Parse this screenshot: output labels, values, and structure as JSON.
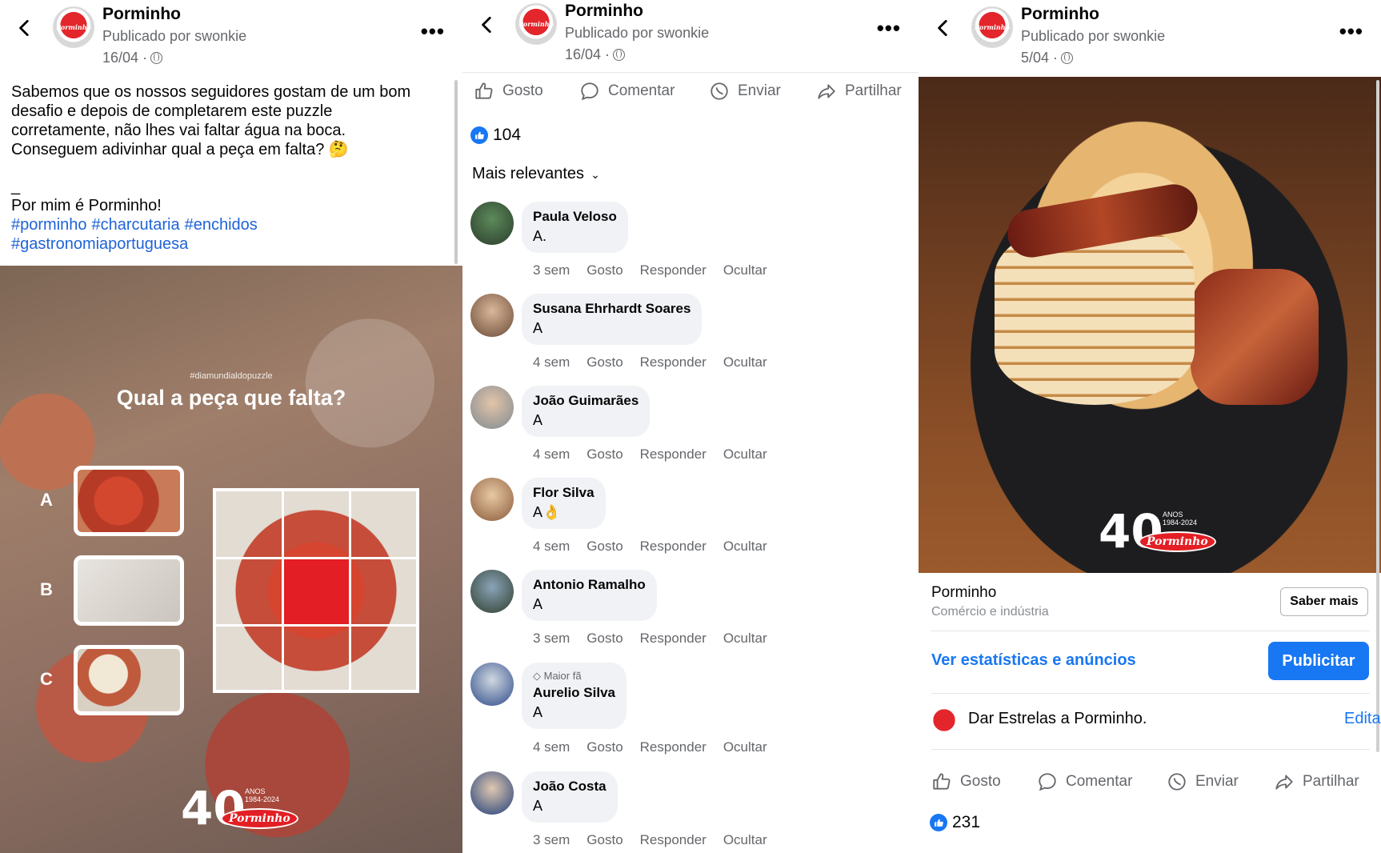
{
  "post1": {
    "page_name": "Porminho",
    "published_by": "Publicado por swonkie",
    "date": "16/04 ·",
    "caption_lines": [
      "Sabemos que os nossos seguidores gostam de um bom",
      "desafio e depois de completarem este puzzle",
      "corretamente, não lhes vai faltar água na boca.",
      "Conseguem adivinhar qual a peça em falta? 🤔",
      "",
      "_",
      "Por mim é Porminho!"
    ],
    "hashtags": [
      "#porminho",
      "#charcutaria",
      "#enchidos",
      "#gastronomiaportuguesa"
    ],
    "image": {
      "hashtag": "#diamundialdopuzzle",
      "question": "Qual a peça que falta?",
      "options": [
        "A",
        "B",
        "C"
      ],
      "anniversary": "40",
      "anos": "ANOS",
      "years": "1984-2024",
      "brand": "Porminho"
    }
  },
  "post2": {
    "page_name": "Porminho",
    "published_by": "Publicado por swonkie",
    "date": "16/04 ·",
    "actions": [
      "Gosto",
      "Comentar",
      "Enviar",
      "Partilhar"
    ],
    "likes": "104",
    "sort_label": "Mais relevantes",
    "comments": [
      {
        "name": "Paula Veloso",
        "text": "A.",
        "time": "3 sem",
        "fan": ""
      },
      {
        "name": "Susana Ehrhardt Soares",
        "text": "A",
        "time": "4 sem",
        "fan": ""
      },
      {
        "name": "João Guimarães",
        "text": "A",
        "time": "4 sem",
        "fan": ""
      },
      {
        "name": "Flor Silva",
        "text": "A👌",
        "time": "4 sem",
        "fan": ""
      },
      {
        "name": "Antonio Ramalho",
        "text": "A",
        "time": "3 sem",
        "fan": ""
      },
      {
        "name": "Aurelio Silva",
        "text": "A",
        "time": "4 sem",
        "fan": "Maior fã"
      },
      {
        "name": "João Costa",
        "text": "A",
        "time": "3 sem",
        "fan": ""
      }
    ],
    "comment_actions": [
      "Gosto",
      "Responder",
      "Ocultar"
    ]
  },
  "post3": {
    "page_name": "Porminho",
    "published_by": "Publicado por swonkie",
    "date": "5/04 ·",
    "image": {
      "anniversary": "40",
      "anos": "ANOS",
      "years": "1984-2024",
      "brand": "Porminho"
    },
    "ad_name": "Porminho",
    "ad_category": "Comércio e indústria",
    "saber_mais": "Saber mais",
    "stats_link": "Ver estatísticas e anúncios",
    "publicitar": "Publicitar",
    "stars_text": "Dar Estrelas a Porminho.",
    "edit": "Editar",
    "actions": [
      "Gosto",
      "Comentar",
      "Enviar",
      "Partilhar"
    ],
    "likes": "231"
  },
  "colors": {
    "brand_red": "#e31e24",
    "link_blue": "#1877f2",
    "meta_gray": "#65676b"
  }
}
